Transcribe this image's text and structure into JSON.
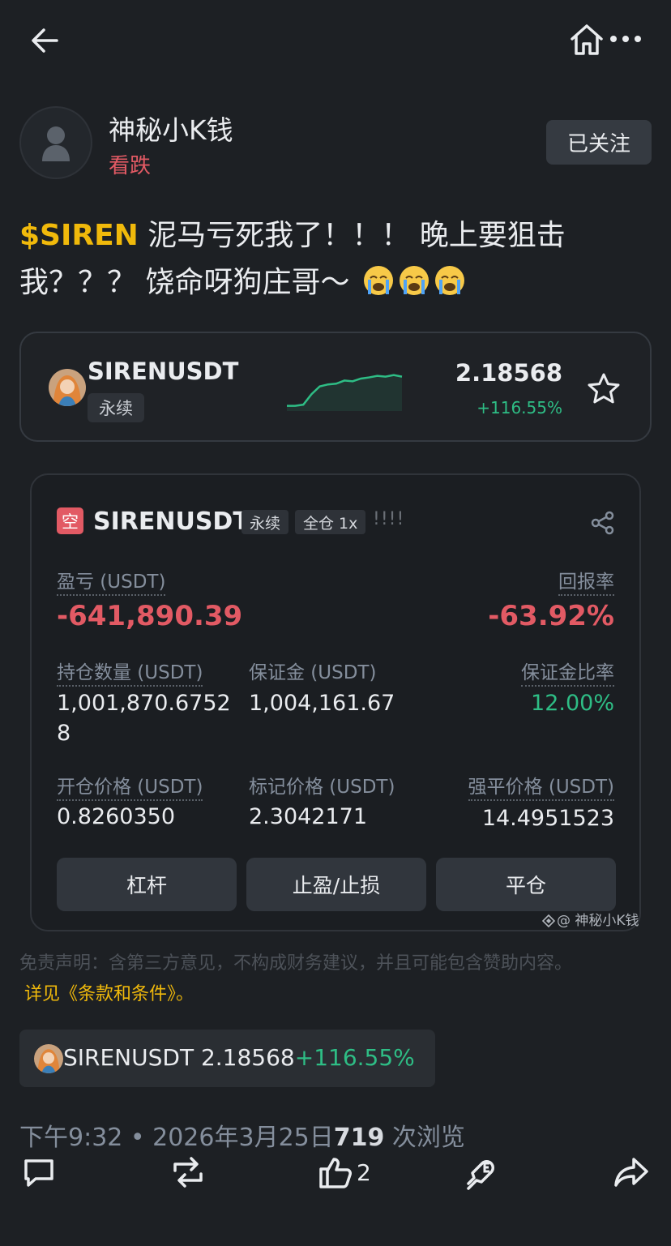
{
  "header": {
    "back_icon": "arrow-left-icon",
    "home_icon": "home-icon",
    "more_icon": "more-horizontal-icon"
  },
  "author": {
    "name": "神秘小K钱",
    "sentiment": "看跌",
    "follow_label": "已关注"
  },
  "post": {
    "tag": "$SIREN",
    "text": " 泥马亏死我了！！！ 晚上要狙击我？？？ 饶命呀狗庄哥～",
    "emoji": "loudly-crying-face"
  },
  "ticker_card": {
    "symbol": "SIRENUSDT",
    "tag": "永续",
    "price": "2.18568",
    "change": "+116.55%",
    "star_icon": "star-outline-icon",
    "sparkline_trend": [
      0.05,
      0.05,
      0.08,
      0.35,
      0.55,
      0.6,
      0.62,
      0.7,
      0.68,
      0.75,
      0.78,
      0.82,
      0.8,
      0.84,
      0.8
    ]
  },
  "position": {
    "side_badge": "空",
    "symbol": "SIRENUSDT",
    "type_tag": "永续",
    "margin_tag": "全仓 1x",
    "warning": "!!!!",
    "share_icon": "share-icon",
    "pnl_label": "盈亏 (USDT)",
    "pnl_value": "-641,890.39",
    "roe_label": "回报率",
    "roe_value": "-63.92%",
    "size_label": "持仓数量 (USDT)",
    "size_value_line1": "1,001,870.6752",
    "size_value_line2": "8",
    "margin_label": "保证金 (USDT)",
    "margin_value": "1,004,161.67",
    "margin_ratio_label": "保证金比率",
    "margin_ratio_value": "12.00%",
    "entry_label": "开仓价格 (USDT)",
    "entry_value": "0.8260350",
    "mark_label": "标记价格 (USDT)",
    "mark_value": "2.3042171",
    "liq_label": "强平价格 (USDT)",
    "liq_value": "14.4951523",
    "buttons": [
      "杠杆",
      "止盈/止损",
      "平仓"
    ],
    "watermark": "@ 神秘小K钱"
  },
  "disclaimer": {
    "text": "免责声明：含第三方意见，不构成财务建议，并且可能包含赞助内容。",
    "link": "详见《条款和条件》。"
  },
  "chip": {
    "symbol": "SIRENUSDT",
    "price": " 2.18568",
    "change": "+116.55%"
  },
  "meta": {
    "time": "下午9:32 • 2026年3月25日",
    "views": "719",
    "views_label": " 次浏览"
  },
  "actions": {
    "comment_icon": "comment-icon",
    "repost_icon": "repost-icon",
    "like_icon": "thumbs-up-icon",
    "like_count": "2",
    "tip_icon": "tip-icon",
    "share_icon": "forward-share-icon"
  },
  "colors": {
    "background": "#1d2024",
    "accent_yellow": "#f0b90b",
    "down_red": "#e25a64",
    "up_green": "#2ebd85"
  }
}
